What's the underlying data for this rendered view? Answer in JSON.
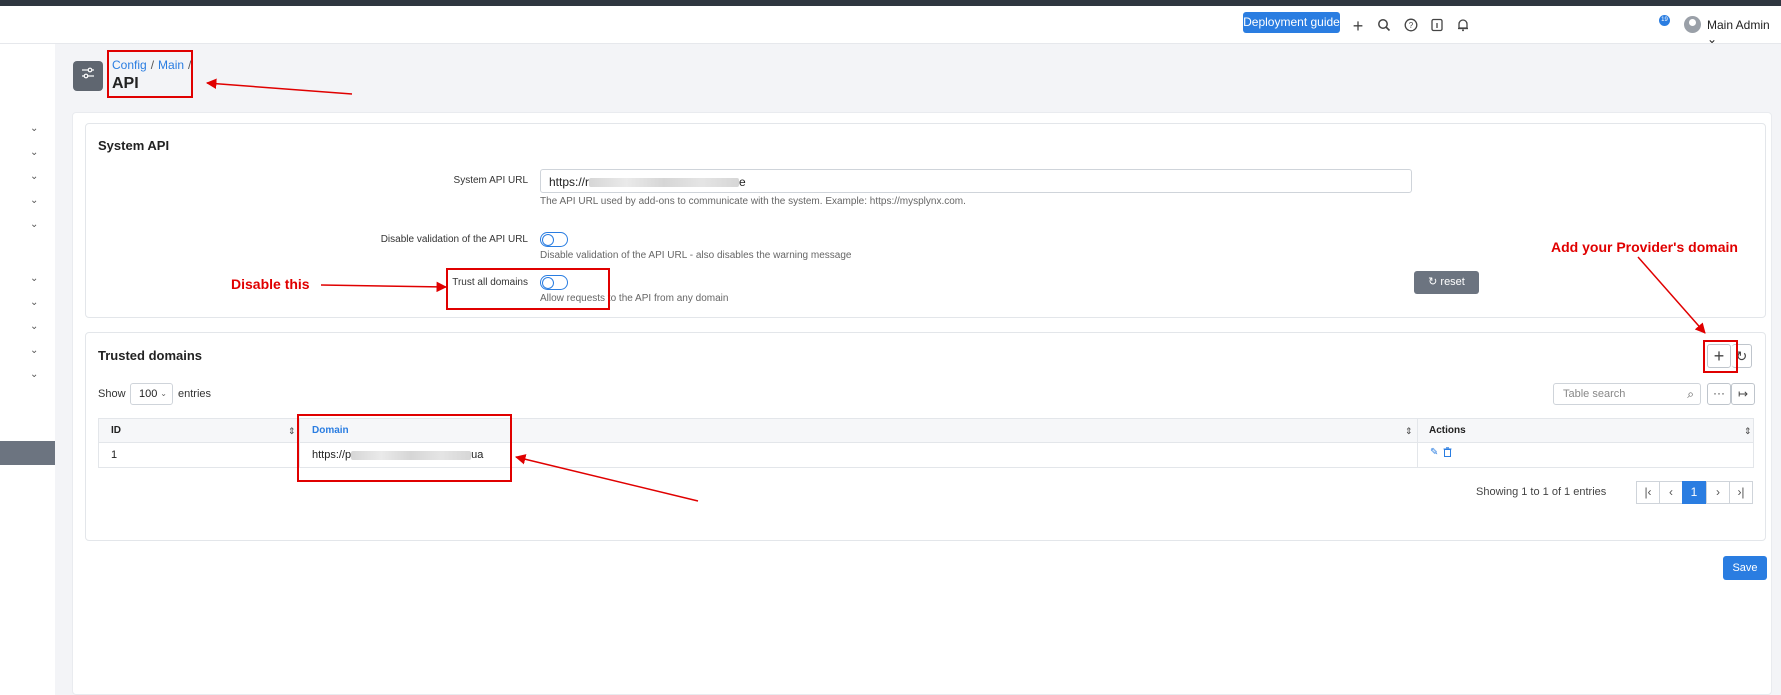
{
  "topbar": {
    "deployment_button": "Deployment guide",
    "notification_count": "19",
    "user_name": "Main Admin"
  },
  "breadcrumb": {
    "items": [
      "Config",
      "Main"
    ],
    "separator": "/"
  },
  "page": {
    "title": "API"
  },
  "system_api": {
    "title": "System API",
    "url_label": "System API URL",
    "url_value_start": "https://r",
    "url_value_end": "e",
    "url_hint": "The API URL used by add-ons to communicate with the system. Example: https://mysplynx.com.",
    "disable_validation_label": "Disable validation of the API URL",
    "disable_validation_hint": "Disable validation of the API URL - also disables the warning message",
    "trust_all_label": "Trust all domains",
    "trust_all_hint": "Allow requests to the API from any domain",
    "reset_label": "reset"
  },
  "trusted_domains": {
    "title": "Trusted domains",
    "show_label": "Show",
    "entries_value": "100",
    "entries_label": "entries",
    "search_placeholder": "Table search",
    "columns": [
      "ID",
      "Domain",
      "Actions"
    ],
    "rows": [
      {
        "id": "1",
        "domain_start": "https://p",
        "domain_end": "ua"
      }
    ],
    "showing_text": "Showing 1 to 1 of 1 entries",
    "current_page": "1"
  },
  "save_label": "Save",
  "annotations": {
    "disable_this": "Disable this",
    "add_provider": "Add your Provider's domain"
  },
  "colors": {
    "accent": "#2a7de1",
    "annotation": "#e00000",
    "topstrip": "#2f3640"
  }
}
